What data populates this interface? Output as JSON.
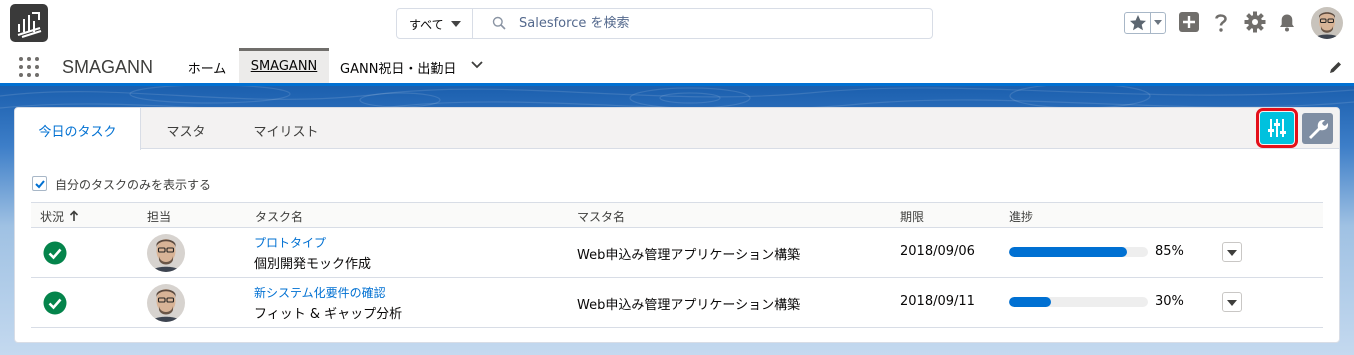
{
  "header": {
    "search": {
      "scope_label": "すべて",
      "placeholder": "Salesforce を検索"
    },
    "icons": [
      "app-logo-icon",
      "search-icon",
      "star-icon",
      "plus-icon",
      "help-icon",
      "gear-icon",
      "bell-icon"
    ]
  },
  "nav": {
    "app_name": "SMAGANN",
    "tabs": [
      {
        "label": "ホーム"
      },
      {
        "label": "SMAGANN"
      },
      {
        "label": "GANN祝日・出勤日"
      }
    ]
  },
  "card": {
    "tabs": [
      {
        "label": "今日のタスク"
      },
      {
        "label": "マスタ"
      },
      {
        "label": "マイリスト"
      }
    ],
    "filter_checkbox": {
      "label": "自分のタスクのみを表示する",
      "checked": true
    },
    "table": {
      "columns": [
        "状況",
        "担当",
        "タスク名",
        "マスタ名",
        "期限",
        "進捗"
      ],
      "rows": [
        {
          "status": "complete",
          "task_link": "プロトタイプ",
          "task_name": "個別開発モック作成",
          "master": "Web申込み管理アプリケーション構築",
          "due": "2018/09/06",
          "progress_text": "85%",
          "progress": 0.85
        },
        {
          "status": "complete",
          "task_link": "新システム化要件の確認",
          "task_name": "フィット & ギャップ分析",
          "master": "Web申込み管理アプリケーション構築",
          "due": "2018/09/11",
          "progress_text": "30%",
          "progress": 0.3
        }
      ]
    }
  },
  "colors": {
    "brand_blue": "#0070d2",
    "filter_button": "#00c1de",
    "highlight_outline": "#e4101a",
    "success": "#04844b"
  }
}
